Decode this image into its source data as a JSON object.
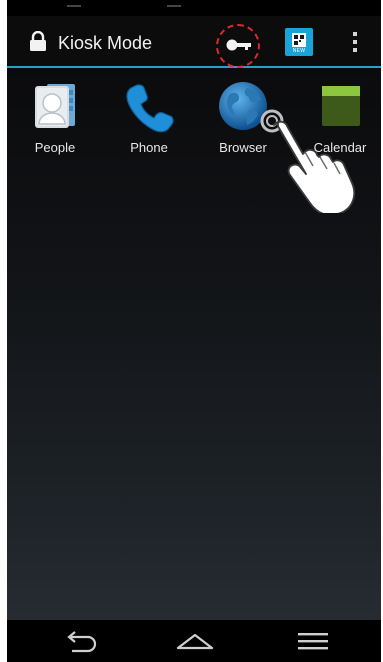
{
  "actionbar": {
    "title": "Kiosk Mode",
    "qr_tiny_label": "NEW",
    "icons": [
      "lock-icon",
      "key-icon",
      "qr-app-icon",
      "overflow-menu-icon"
    ],
    "accent_color": "#2a9fc9",
    "highlight_color": "#e0262e"
  },
  "apps": [
    {
      "label": "People",
      "icon": "contacts-icon"
    },
    {
      "label": "Phone",
      "icon": "phone-icon"
    },
    {
      "label": "Browser",
      "icon": "globe-icon"
    },
    {
      "label": "Calendar",
      "icon": "calendar-icon"
    }
  ],
  "navbar": {
    "icons": [
      "back-icon",
      "home-icon",
      "recent-apps-icon"
    ]
  }
}
